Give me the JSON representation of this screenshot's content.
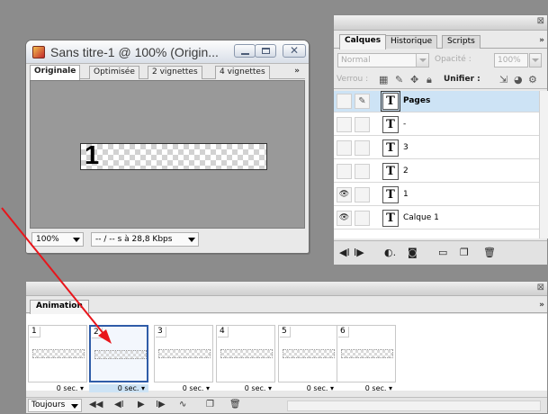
{
  "document_window": {
    "title": "Sans titre-1 @ 100% (Origin...",
    "tabs": [
      "Originale",
      "Optimisée",
      "2 vignettes",
      "4 vignettes"
    ],
    "tabs_overflow": "»",
    "canvas_text": "1",
    "zoom": "100%",
    "status": "-- / -- s à 28,8 Kbps"
  },
  "layers_panel": {
    "close": "⊠",
    "tabs": [
      "Calques",
      "Historique",
      "Scripts"
    ],
    "tabs_overflow": "»",
    "blend_mode": "Normal",
    "opacity_label": "Opacité :",
    "opacity_value": "100%",
    "lock_label": "Verrou :",
    "unify_label": "Unifier :",
    "layers": [
      {
        "name": "Pages",
        "selected": true,
        "visible": false
      },
      {
        "name": "-",
        "selected": false,
        "visible": false
      },
      {
        "name": "3",
        "selected": false,
        "visible": false
      },
      {
        "name": "2",
        "selected": false,
        "visible": false
      },
      {
        "name": "1",
        "selected": false,
        "visible": true
      },
      {
        "name": "Calque 1",
        "selected": false,
        "visible": true
      }
    ],
    "thumb_glyph": "T"
  },
  "animation_panel": {
    "close": "⊠",
    "tab": "Animation",
    "tabs_overflow": "»",
    "frames": [
      {
        "num": "1",
        "delay": "0 sec. ▾",
        "selected": false
      },
      {
        "num": "2",
        "delay": "0 sec. ▾",
        "selected": true
      },
      {
        "num": "3",
        "delay": "0 sec. ▾",
        "selected": false
      },
      {
        "num": "4",
        "delay": "0 sec. ▾",
        "selected": false
      },
      {
        "num": "5",
        "delay": "0 sec. ▾",
        "selected": false
      },
      {
        "num": "6",
        "delay": "0 sec. ▾",
        "selected": false
      }
    ],
    "loop": "Toujours"
  },
  "colors": {
    "annotation_arrow": "#e8151b",
    "selection": "#cde3f5",
    "selected_frame_border": "#2f5ca8"
  }
}
